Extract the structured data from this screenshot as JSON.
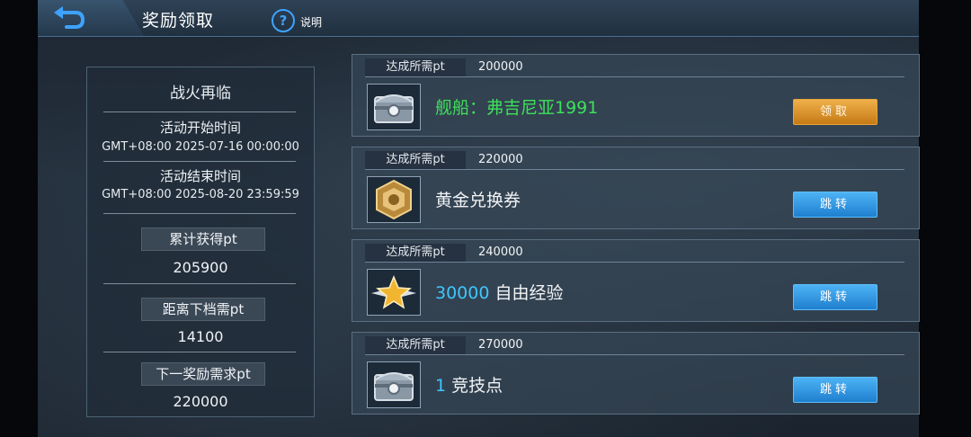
{
  "header": {
    "title": "奖励领取",
    "help_label": "说明"
  },
  "event": {
    "name": "战火再临",
    "start_label": "活动开始时间",
    "start_time": "GMT+08:00 2025-07-16 00:00:00",
    "end_label": "活动结束时间",
    "end_time": "GMT+08:00 2025-08-20 23:59:59",
    "total_label": "累计获得pt",
    "total_value": "205900",
    "next_gap_label": "距离下档需pt",
    "next_gap_value": "14100",
    "next_req_label": "下一奖励需求pt",
    "next_req_value": "220000"
  },
  "rewards": [
    {
      "req_label": "达成所需pt",
      "req_value": "200000",
      "icon": "chest-icon",
      "name_prefix": "",
      "name": "舰船：弗吉尼亚1991",
      "button": "领取",
      "button_type": "claim"
    },
    {
      "req_label": "达成所需pt",
      "req_value": "220000",
      "icon": "gold-voucher-icon",
      "name_prefix": "",
      "name": "黄金兑换券",
      "button": "跳转",
      "button_type": "jump"
    },
    {
      "req_label": "达成所需pt",
      "req_value": "240000",
      "icon": "star-icon",
      "name_prefix": "30000",
      "name": " 自由经验",
      "button": "跳转",
      "button_type": "jump"
    },
    {
      "req_label": "达成所需pt",
      "req_value": "270000",
      "icon": "chest-icon",
      "name_prefix": "1",
      "name": " 竞技点",
      "button": "跳转",
      "button_type": "jump"
    }
  ],
  "colors": {
    "claim_green": "#3ee05a",
    "accent_cyan": "#3ec6ff",
    "claim_button": "#e09a2e",
    "jump_button": "#2f95e0"
  }
}
